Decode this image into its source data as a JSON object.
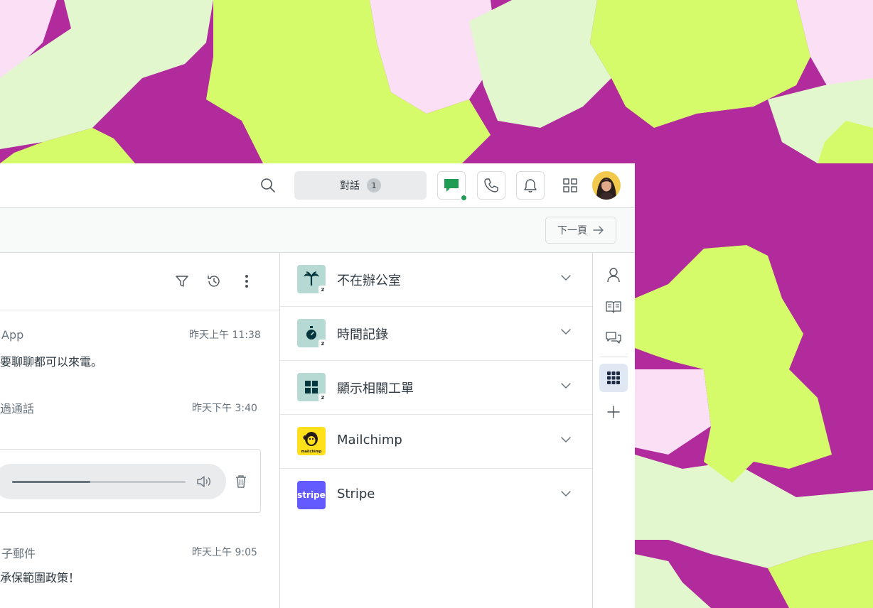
{
  "topbar": {
    "conversations_label": "對話",
    "conversations_count": "1",
    "active_color": "#1f9d55"
  },
  "subbar": {
    "next_label": "下一頁"
  },
  "messages": [
    {
      "label": "App",
      "time": "昨天上午 11:38",
      "body": "要聊聊都可以來電。"
    },
    {
      "label": "過通話",
      "time": "昨天下午 3:40"
    },
    {
      "label": "子郵件",
      "time": "昨天上午 9:05",
      "body": "承保範圍政策！"
    }
  ],
  "audio": {
    "progress": 0.45
  },
  "apps": [
    {
      "name": "不在辦公室",
      "icon": "palm-tree-icon"
    },
    {
      "name": "時間記錄",
      "icon": "stopwatch-icon"
    },
    {
      "name": "顯示相關工單",
      "icon": "grid-tiles-icon"
    },
    {
      "name": "Mailchimp",
      "icon": "mailchimp-logo",
      "logo_text": "mailchimp"
    },
    {
      "name": "Stripe",
      "icon": "stripe-logo",
      "logo_text": "stripe"
    }
  ],
  "colors": {
    "magenta": "#b12b9c",
    "lime": "#d6fb6a",
    "pink": "#fbe0f5",
    "pale_green": "#e3f7cf",
    "app_tile": "#b6d9d3",
    "stripe": "#635bff",
    "mailchimp": "#ffe01b"
  }
}
